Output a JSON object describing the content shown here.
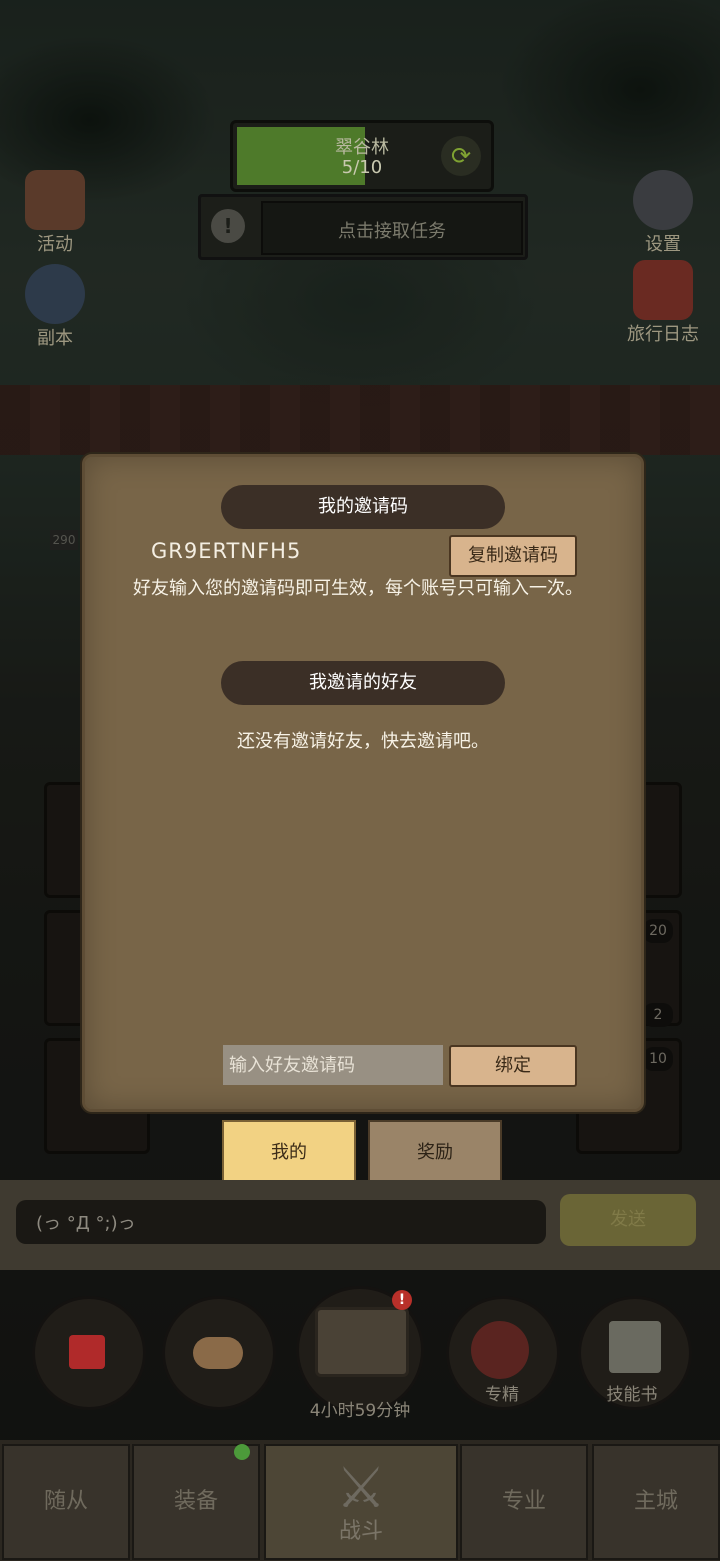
{
  "hud": {
    "area_name": "翠谷林",
    "area_progress": "5/10",
    "quest_text": "点击接取任务"
  },
  "side_left": [
    {
      "label": "活动",
      "icon": "scroll-board-icon"
    },
    {
      "label": "副本",
      "icon": "portal-crystal-icon"
    }
  ],
  "side_right": [
    {
      "label": "设置",
      "icon": "gear-icon"
    },
    {
      "label": "旅行日志",
      "icon": "journal-book-icon"
    }
  ],
  "dialog": {
    "invite_code_title": "我的邀请码",
    "invite_code": "GR9ERTNFH5",
    "copy_button": "复制邀请码",
    "description": "好友输入您的邀请码即可生效，每个账号只可输入一次。",
    "invited_friends_title": "我邀请的好友",
    "empty_message": "还没有邀请好友，快去邀请吧。",
    "input_placeholder": "输入好友邀请码",
    "bind_button": "绑定"
  },
  "tabs": [
    {
      "label": "我的",
      "active": true
    },
    {
      "label": "奖励",
      "active": false
    }
  ],
  "chat": {
    "value": "(っ °Д °;)っ",
    "send_label": "发送"
  },
  "slot_counts": [
    "20",
    "2",
    "10"
  ],
  "side_counter": "290",
  "quick_items": [
    {
      "icon": "red-potion-icon"
    },
    {
      "icon": "bread-icon"
    },
    {
      "icon": "treasure-chest-icon",
      "label": "4小时59分钟",
      "alert": "!"
    },
    {
      "icon": "mastery-icon",
      "label": "专精"
    },
    {
      "icon": "skill-book-icon",
      "label": "技能书"
    }
  ],
  "nav": [
    {
      "label": "随从"
    },
    {
      "label": "装备"
    },
    {
      "label": "战斗",
      "icon": "crossed-swords-icon"
    },
    {
      "label": "专业"
    },
    {
      "label": "主城"
    }
  ],
  "colors": {
    "dialog_bg": "#786548",
    "banner_bg": "#3b2f26",
    "button_bg": "#d8b48d",
    "active_tab": "#f2d283"
  }
}
